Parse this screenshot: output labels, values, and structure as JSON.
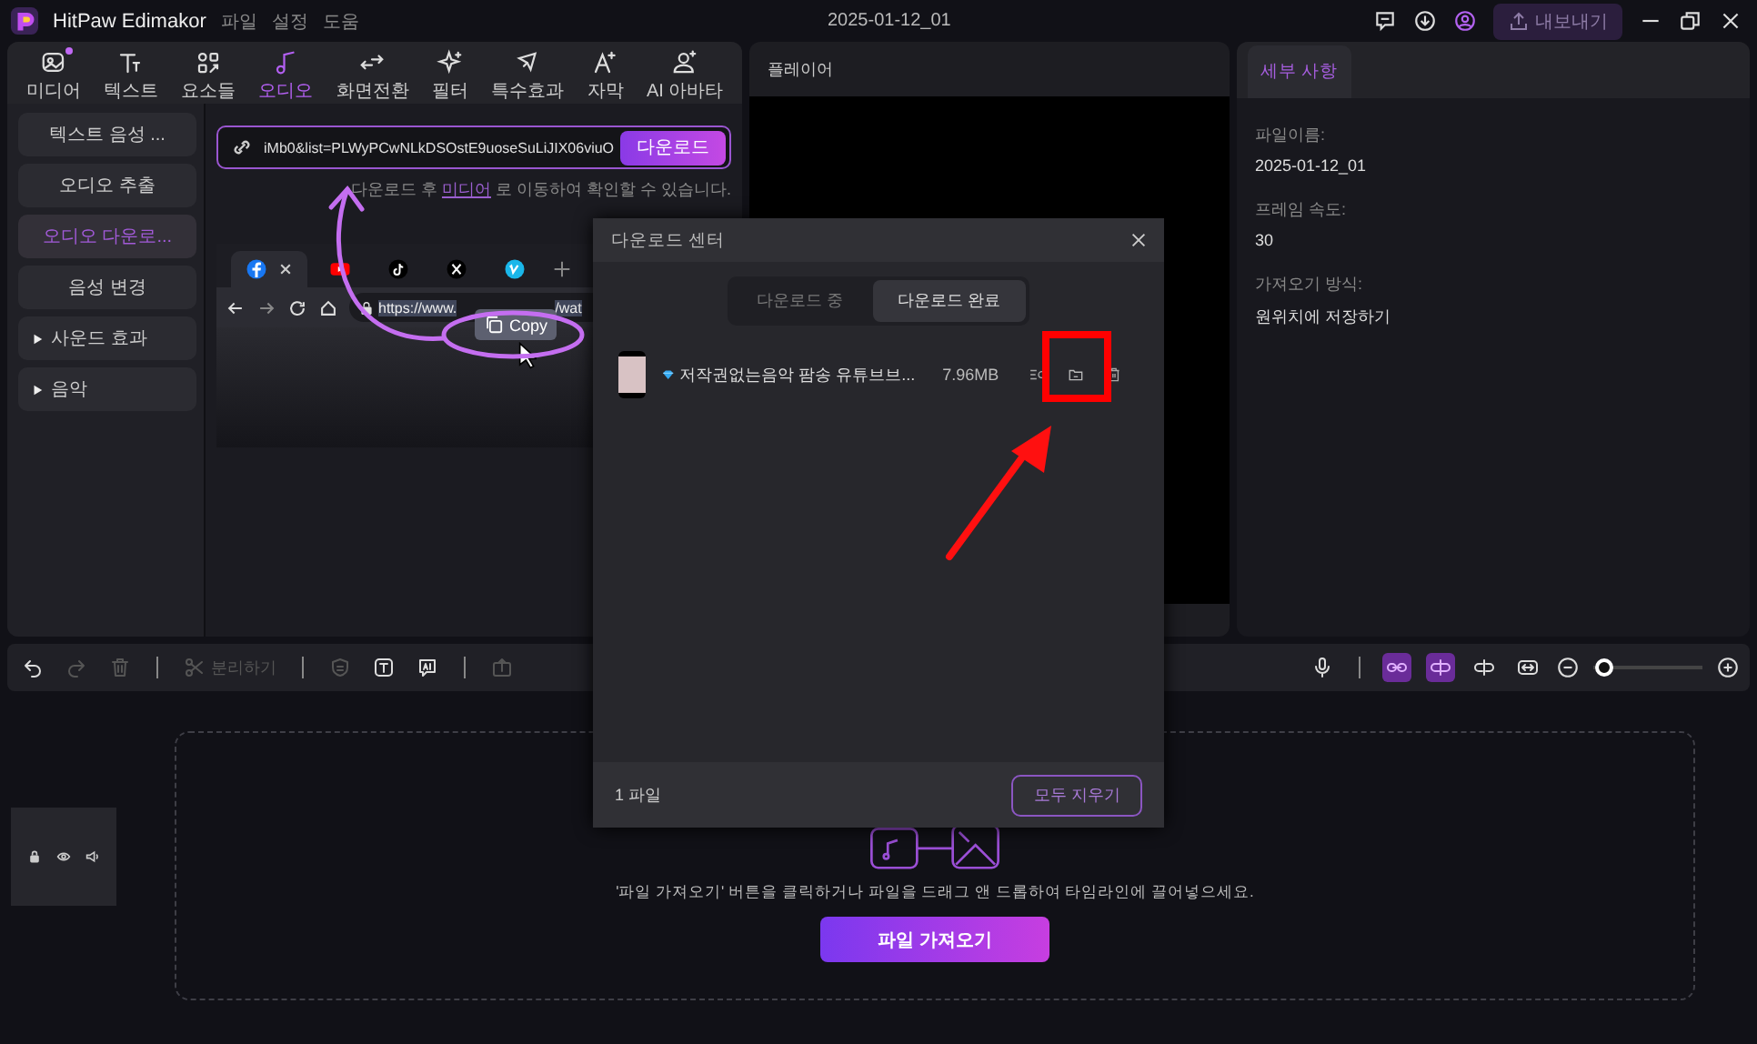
{
  "app": {
    "name": "HitPaw Edimakor",
    "menus": [
      "파일",
      "설정",
      "도움"
    ],
    "project_title": "2025-01-12_01",
    "export_label": "내보내기"
  },
  "toolbar_tabs": [
    {
      "label": "미디어",
      "kind": "media",
      "selected": false,
      "badge": true
    },
    {
      "label": "텍스트",
      "kind": "text",
      "selected": false,
      "badge": false
    },
    {
      "label": "요소들",
      "kind": "elements",
      "selected": false,
      "badge": false
    },
    {
      "label": "오디오",
      "kind": "audio",
      "selected": true,
      "badge": false
    },
    {
      "label": "화면전환",
      "kind": "transition",
      "selected": false,
      "badge": false
    },
    {
      "label": "필터",
      "kind": "filter",
      "selected": false,
      "badge": false
    },
    {
      "label": "특수효과",
      "kind": "effects",
      "selected": false,
      "badge": false
    },
    {
      "label": "자막",
      "kind": "subtitle",
      "selected": false,
      "badge": false
    },
    {
      "label": "AI 아바타",
      "kind": "avatar",
      "selected": false,
      "badge": false
    }
  ],
  "sidebar": {
    "items": [
      {
        "label": "텍스트 음성 ...",
        "kind": "item",
        "selected": false
      },
      {
        "label": "오디오 추출",
        "kind": "item",
        "selected": false
      },
      {
        "label": "오디오 다운로...",
        "kind": "item",
        "selected": true
      },
      {
        "label": "음성 변경",
        "kind": "item",
        "selected": false
      },
      {
        "label": "사운드 효과",
        "kind": "group",
        "selected": false,
        "expanded": false
      },
      {
        "label": "음악",
        "kind": "group",
        "selected": false,
        "expanded": false
      }
    ]
  },
  "url_download": {
    "value": "iMb0&list=PLWyPCwNLkDSOstE9uoseSuLiJIX06viuO",
    "button": "다운로드",
    "hint_before": "다운로드 후 ",
    "hint_link": "미디어",
    "hint_after": " 로 이동하여 확인할 수 있습니다."
  },
  "browser": {
    "tabs": [
      {
        "kind": "facebook",
        "selected": true
      },
      {
        "kind": "youtube",
        "selected": false
      },
      {
        "kind": "tiktok",
        "selected": false
      },
      {
        "kind": "x",
        "selected": false
      },
      {
        "kind": "vimeo",
        "selected": false
      }
    ],
    "url": "https://www.",
    "url_tail": "/wat",
    "copy_label": "Copy"
  },
  "player": {
    "title": "플레이어"
  },
  "details": {
    "tab": "세부 사항",
    "fields": [
      {
        "label": "파일이름:",
        "value": "2025-01-12_01"
      },
      {
        "label": "프레임 속도:",
        "value": "30"
      },
      {
        "label": "가져오기 방식:",
        "value": "원위치에 저장하기"
      }
    ]
  },
  "download_center": {
    "title": "다운로드 센터",
    "tabs": [
      {
        "label": "다운로드 중",
        "selected": false
      },
      {
        "label": "다운로드 완료",
        "selected": true
      }
    ],
    "items": [
      {
        "title": "저작권없는음악 팜송 유튜브브...",
        "size": "7.96MB"
      }
    ],
    "count": "1 파일",
    "clear_label": "모두 지우기"
  },
  "timeline": {
    "tools": [
      {
        "kind": "undo",
        "disabled": false
      },
      {
        "kind": "redo",
        "disabled": true
      },
      {
        "kind": "delete",
        "disabled": true
      },
      {
        "kind": "separator"
      },
      {
        "kind": "split",
        "label": "분리하기",
        "disabled": true
      },
      {
        "kind": "separator"
      },
      {
        "kind": "shield",
        "disabled": true
      },
      {
        "kind": "textbox",
        "disabled": false
      },
      {
        "kind": "aibox",
        "disabled": false
      },
      {
        "kind": "separator"
      },
      {
        "kind": "export",
        "disabled": true
      }
    ],
    "right_tools": [
      {
        "kind": "mic",
        "on": false
      },
      {
        "kind": "separator"
      },
      {
        "kind": "link",
        "on": true
      },
      {
        "kind": "splitclip",
        "on": true
      },
      {
        "kind": "trim",
        "on": false
      },
      {
        "kind": "fit",
        "on": false
      }
    ],
    "zoom": {
      "level": 0.02
    },
    "hint": "'파일 가져오기' 버튼을 클릭하거나 파일을 드래그 앤 드롭하여 타임라인에 끌어넣으세요.",
    "import_label": "파일 가져오기"
  }
}
